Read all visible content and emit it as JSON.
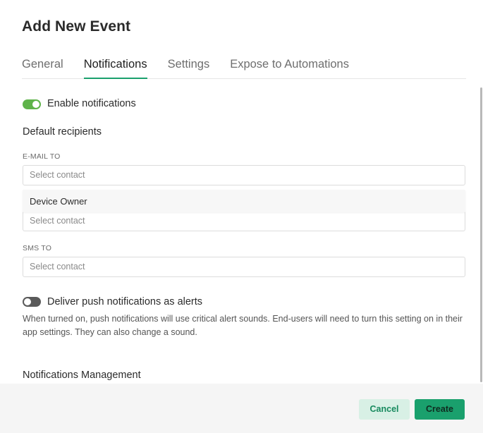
{
  "dialog": {
    "title": "Add New Event"
  },
  "tabs": [
    {
      "label": "General",
      "active": false
    },
    {
      "label": "Notifications",
      "active": true
    },
    {
      "label": "Settings",
      "active": false
    },
    {
      "label": "Expose to Automations",
      "active": false
    }
  ],
  "notifications": {
    "enable_toggle": {
      "label": "Enable notifications",
      "checked": true
    },
    "default_recipients_heading": "Default recipients",
    "email_to": {
      "label": "E-MAIL TO",
      "placeholder": "Select contact"
    },
    "dropdown_option": "Device Owner",
    "second_field": {
      "placeholder": "Select contact"
    },
    "sms_to": {
      "label": "SMS TO",
      "placeholder": "Select contact"
    },
    "push_alerts_toggle": {
      "label": "Deliver push notifications as alerts",
      "checked": false
    },
    "push_alerts_help": "When turned on, push notifications will use critical alert sounds. End-users will need to turn this setting on in their app settings. They can also change a sound.",
    "management_heading": "Notifications Management"
  },
  "footer": {
    "cancel_label": "Cancel",
    "create_label": "Create"
  },
  "colors": {
    "accent": "#1aa06d",
    "toggle_on": "#5fb34a",
    "toggle_off": "#5a5a5a"
  }
}
